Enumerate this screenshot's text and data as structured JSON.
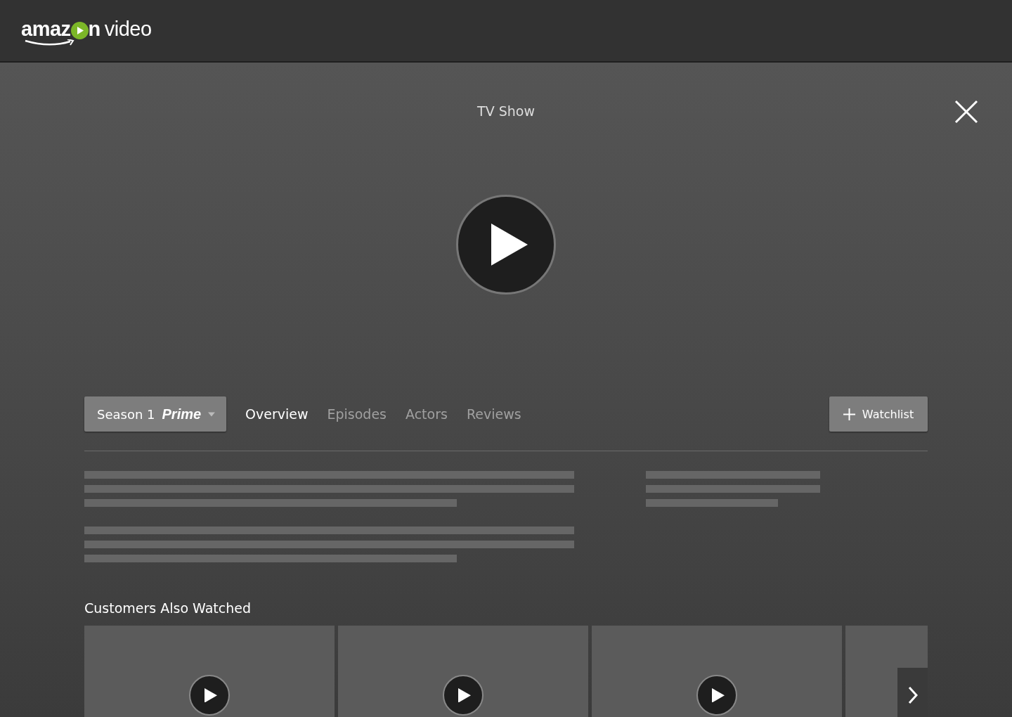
{
  "logo": {
    "before": "amaz",
    "after": "n",
    "suffix": "video"
  },
  "title": "TV Show",
  "season": {
    "label": "Season 1",
    "badge": "Prime"
  },
  "tabs": [
    {
      "label": "Overview",
      "selected": true
    },
    {
      "label": "Episodes",
      "selected": false
    },
    {
      "label": "Actors",
      "selected": false
    },
    {
      "label": "Reviews",
      "selected": false
    }
  ],
  "watchlist": {
    "label": "Watchlist"
  },
  "related": {
    "title": "Customers Also Watched",
    "items": [
      {
        "kind": "video"
      },
      {
        "kind": "video"
      },
      {
        "kind": "video"
      },
      {
        "kind": "partial"
      }
    ]
  }
}
